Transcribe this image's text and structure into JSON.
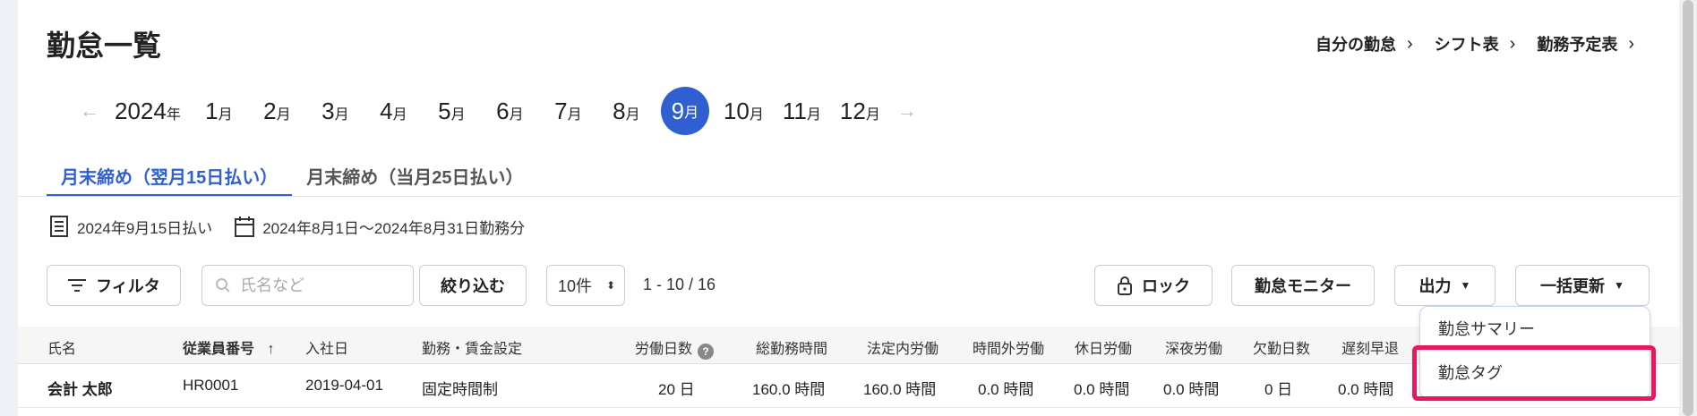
{
  "header": {
    "title": "勤怠一覧",
    "links": [
      {
        "label": "自分の勤怠"
      },
      {
        "label": "シフト表"
      },
      {
        "label": "勤務予定表"
      }
    ]
  },
  "calendar": {
    "year": "2024",
    "year_suffix": "年",
    "month_suffix": "月",
    "months": [
      "1",
      "2",
      "3",
      "4",
      "5",
      "6",
      "7",
      "8",
      "9",
      "10",
      "11",
      "12"
    ],
    "selected_month": "9"
  },
  "tabs": [
    {
      "label": "月末締め（翌月15日払い）",
      "active": true
    },
    {
      "label": "月末締め（当月25日払い）",
      "active": false
    }
  ],
  "info": {
    "pay_date": "2024年9月15日払い",
    "period": "2024年8月1日〜2024年8月31日勤務分"
  },
  "toolbar": {
    "filter_label": "フィルタ",
    "search_placeholder": "氏名など",
    "narrow_label": "絞り込む",
    "per_page": "10件",
    "range": "1 - 10 / 16",
    "lock_label": "ロック",
    "monitor_label": "勤怠モニター",
    "export_label": "出力",
    "bulk_update_label": "一括更新"
  },
  "table": {
    "columns": [
      "氏名",
      "従業員番号",
      "入社日",
      "勤務・賃金設定",
      "労働日数",
      "総勤務時間",
      "法定内労働",
      "時間外労働",
      "休日労働",
      "深夜労働",
      "欠勤日数",
      "遅刻早退"
    ],
    "sort_indicator": "↑",
    "rows": [
      {
        "name": "会計 太郎",
        "employee_no": "HR0001",
        "hire_date": "2019-04-01",
        "setting": "固定時間制",
        "work_days": "20 日",
        "total_hours": "160.0 時間",
        "legal_hours": "160.0 時間",
        "overtime": "0.0 時間",
        "holiday": "0.0 時間",
        "night": "0.0 時間",
        "absence": "0 日",
        "late_early": "0.0 時間"
      }
    ]
  },
  "dropdown": {
    "items": [
      "勤怠サマリー",
      "勤怠タグ"
    ]
  },
  "colors": {
    "accent": "#2f5fd0",
    "highlight": "#e8185f"
  }
}
